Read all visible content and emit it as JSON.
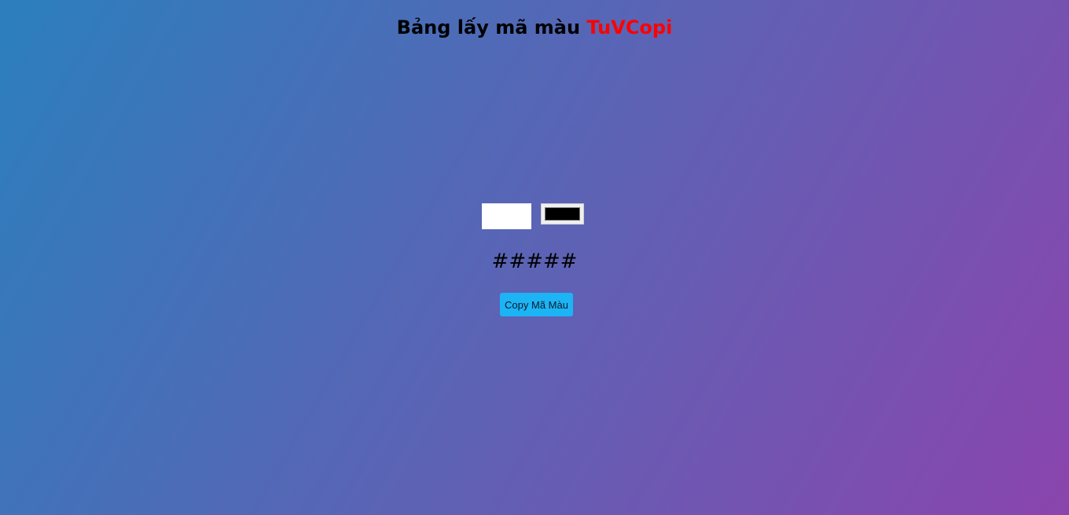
{
  "header": {
    "title_prefix": "Bảng lấy mã màu",
    "title_brand": "TuVCopi"
  },
  "picker": {
    "text_value": "",
    "color_value": "#000000"
  },
  "result": {
    "hex_text": "#####"
  },
  "actions": {
    "copy_label": "Copy Mã Màu"
  },
  "colors": {
    "gradient_start": "#2b7fbd",
    "gradient_end": "#8a45ad",
    "brand": "#ff0000",
    "button": "#1cb4f5"
  }
}
